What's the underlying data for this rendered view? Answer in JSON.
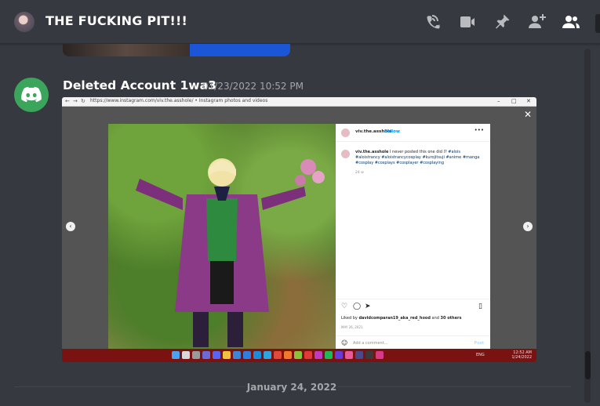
{
  "header": {
    "channel_name": "THE FUCKING PIT!!!",
    "icons": [
      "calls-icon",
      "video-icon",
      "pin-icon",
      "add-member-icon",
      "member-list-icon"
    ]
  },
  "message": {
    "author": "Deleted Account 1wa3",
    "timestamp": "01/23/2022 10:52 PM",
    "avatar_color": "#3ba55c"
  },
  "attachment": {
    "browser_url": "https://www.instagram.com/viv.the.asshole/ • Instagram photos and videos",
    "instagram": {
      "username": "viv.the.asshole",
      "follow_label": "Follow",
      "caption_text": "I never posted this one did I?",
      "hashtags": "#alois #aloistrancy #aloistrancycosplay #kurojitsuji #anime #manga #cosplay #cosplays #cosplayer #cosplaying",
      "ago": "24 w",
      "liked_by_user": "davidcomparan19_aka_red_hood",
      "liked_by_others": "30 others",
      "liked_prefix": "Liked by",
      "liked_and": "and",
      "post_date": "MAY 26, 2021",
      "comment_placeholder": "Add a comment...",
      "post_label": "Post"
    },
    "taskbar": {
      "lang": "ENG",
      "time": "12:52 AM",
      "date": "1/24/2022",
      "color": "#7a1212"
    }
  },
  "divider": {
    "date_label": "January 24, 2022"
  },
  "colors": {
    "background": "#36393f",
    "text_primary": "#ffffff",
    "text_muted": "#a3a6aa",
    "link_blue": "#0095f6"
  }
}
